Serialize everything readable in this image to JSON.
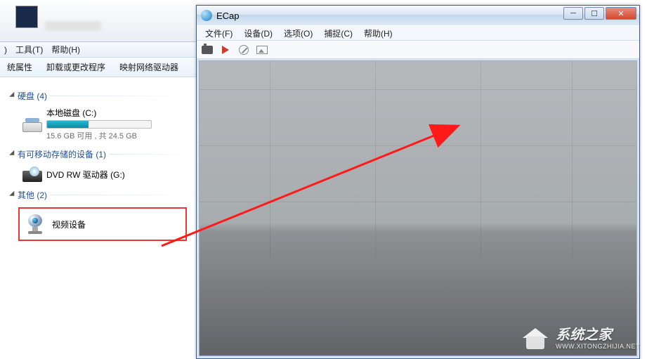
{
  "explorer": {
    "menubar": {
      "view": ")",
      "tools": "工具(T)",
      "help": "帮助(H)"
    },
    "toolbar": {
      "props": "统属性",
      "uninstall": "卸载或更改程序",
      "mapnet": "映射网络驱动器"
    },
    "sections": {
      "disks": {
        "title": "硬盘 (4)"
      },
      "removable": {
        "title": "有可移动存储的设备 (1)"
      },
      "other": {
        "title": "其他 (2)"
      }
    },
    "drive": {
      "name": "本地磁盘 (C:)",
      "sub": "15.6 GB 可用 , 共 24.5 GB"
    },
    "dvd": {
      "name": "DVD RW 驱动器 (G:)"
    },
    "video": {
      "name": "视频设备"
    }
  },
  "ecap": {
    "title": "ECap",
    "menubar": {
      "file": "文件(F)",
      "device": "设备(D)",
      "options": "选项(O)",
      "capture": "捕捉(C)",
      "help": "帮助(H)"
    }
  },
  "watermark": {
    "main": "系统之家",
    "sub": "WWW.XITONGZHIJIA.NET"
  }
}
